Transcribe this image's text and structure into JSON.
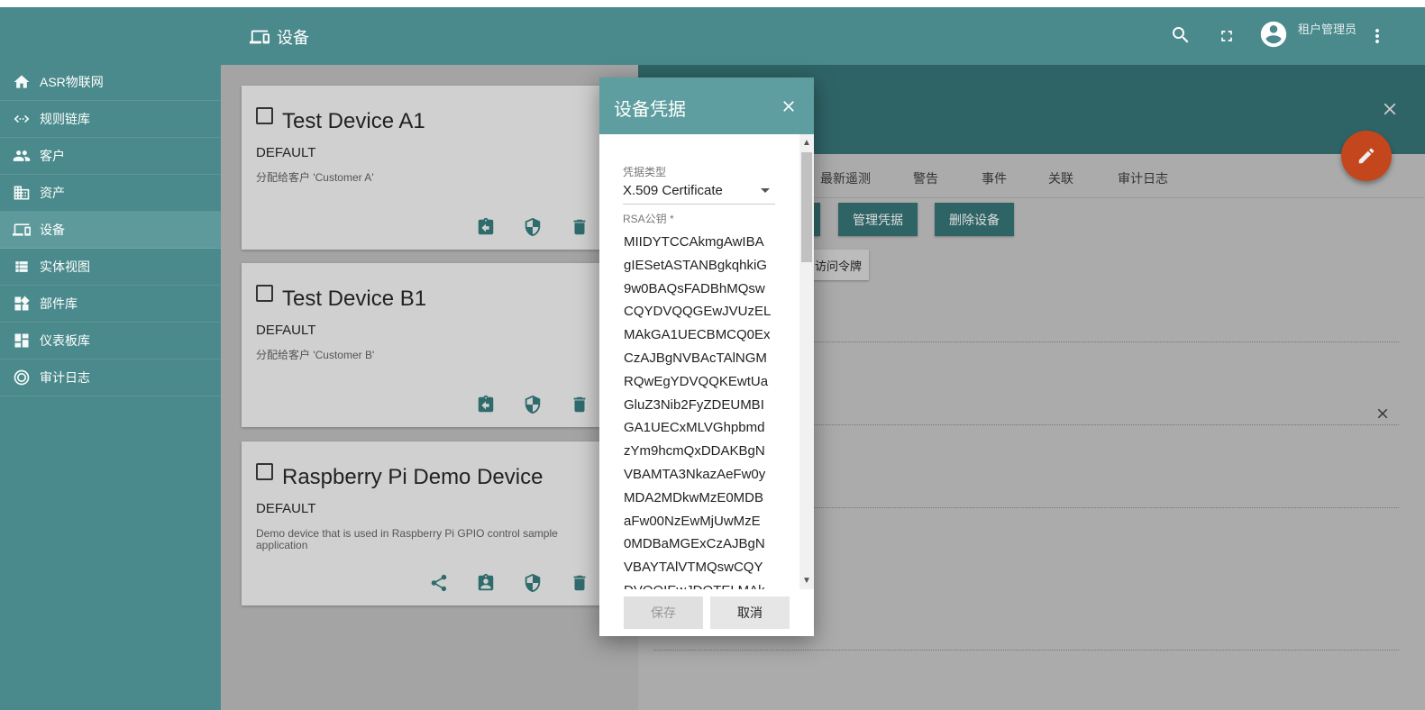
{
  "header": {
    "title": "设备",
    "user_name": "租户管理员"
  },
  "sidebar": {
    "items": [
      {
        "label": "ASR物联网",
        "icon": "home-icon"
      },
      {
        "label": "规则链库",
        "icon": "rule-chain-icon"
      },
      {
        "label": "客户",
        "icon": "customers-icon"
      },
      {
        "label": "资产",
        "icon": "assets-icon"
      },
      {
        "label": "设备",
        "icon": "devices-icon",
        "active": true
      },
      {
        "label": "实体视图",
        "icon": "entity-view-icon"
      },
      {
        "label": "部件库",
        "icon": "widgets-icon"
      },
      {
        "label": "仪表板库",
        "icon": "dashboard-icon"
      },
      {
        "label": "审计日志",
        "icon": "audit-log-icon"
      }
    ]
  },
  "devices": [
    {
      "name": "Test Device A1",
      "type": "DEFAULT",
      "desc": "分配给客户 'Customer A'"
    },
    {
      "name": "Test Device B1",
      "type": "DEFAULT",
      "desc": "分配给客户 'Customer B'"
    },
    {
      "name": "Raspberry Pi Demo Device",
      "type": "DEFAULT",
      "desc": "Demo device that is used in Raspberry Pi GPIO control sample application"
    }
  ],
  "detail": {
    "tabs": [
      "最新遥测",
      "警告",
      "事件",
      "关联",
      "审计日志"
    ],
    "buttons": {
      "manage_credentials": "管理凭据",
      "delete_device": "删除设备",
      "access_token": "访问令牌"
    }
  },
  "dialog": {
    "title": "设备凭据",
    "credential_type_label": "凭据类型",
    "credential_type_value": "X.509 Certificate",
    "rsa_label": "RSA公钥 *",
    "rsa_lines": [
      "MIIDYTCCAkmgAwIBA",
      "gIESetASTANBgkqhkiG",
      "9w0BAQsFADBhMQsw",
      "CQYDVQQGEwJVUzEL",
      "MAkGA1UECBMCQ0Ex",
      "CzAJBgNVBAcTAlNGM",
      "RQwEgYDVQQKEwtUa",
      "GluZ3Nib2FyZDEUMBI",
      "GA1UECxMLVGhpbmd",
      "zYm9hcmQxDDAKBgN",
      "VBAMTA3NkazAeFw0y",
      "MDA2MDkwMzE0MDB",
      "aFw00NzEwMjUwMzE",
      "0MDBaMGExCzAJBgN",
      "VBAYTAlVTMQswCQY",
      "DVQQIEwJDQTELMAk"
    ],
    "save_label": "保存",
    "cancel_label": "取消"
  }
}
